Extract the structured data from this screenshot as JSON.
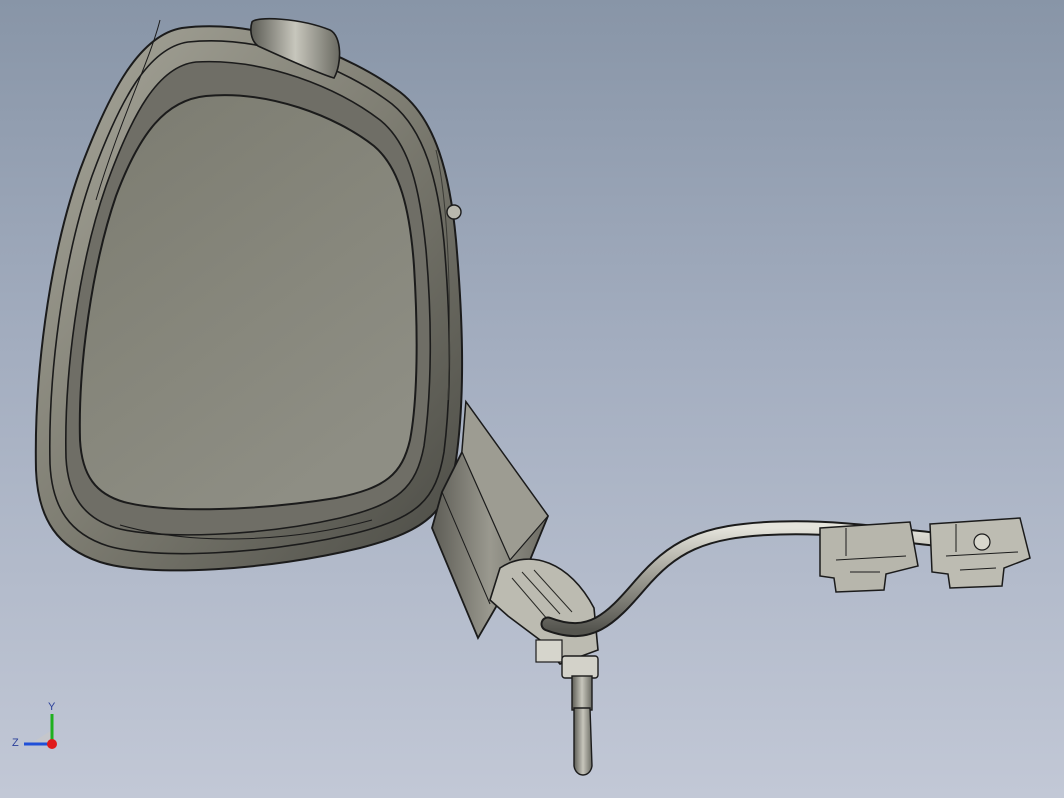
{
  "viewport": {
    "background_top": "#8895a7",
    "background_bottom": "#c2c8d6"
  },
  "model": {
    "subject": "side-mirror-assembly",
    "shell_color": "#7f7e74",
    "glass_color": "#85857a",
    "edge_color": "#1b1b1b"
  },
  "triad": {
    "y_label": "Y",
    "z_label": "Z",
    "x_color": "#e01a1a",
    "y_color": "#1fb01f",
    "z_color": "#2050d8"
  }
}
